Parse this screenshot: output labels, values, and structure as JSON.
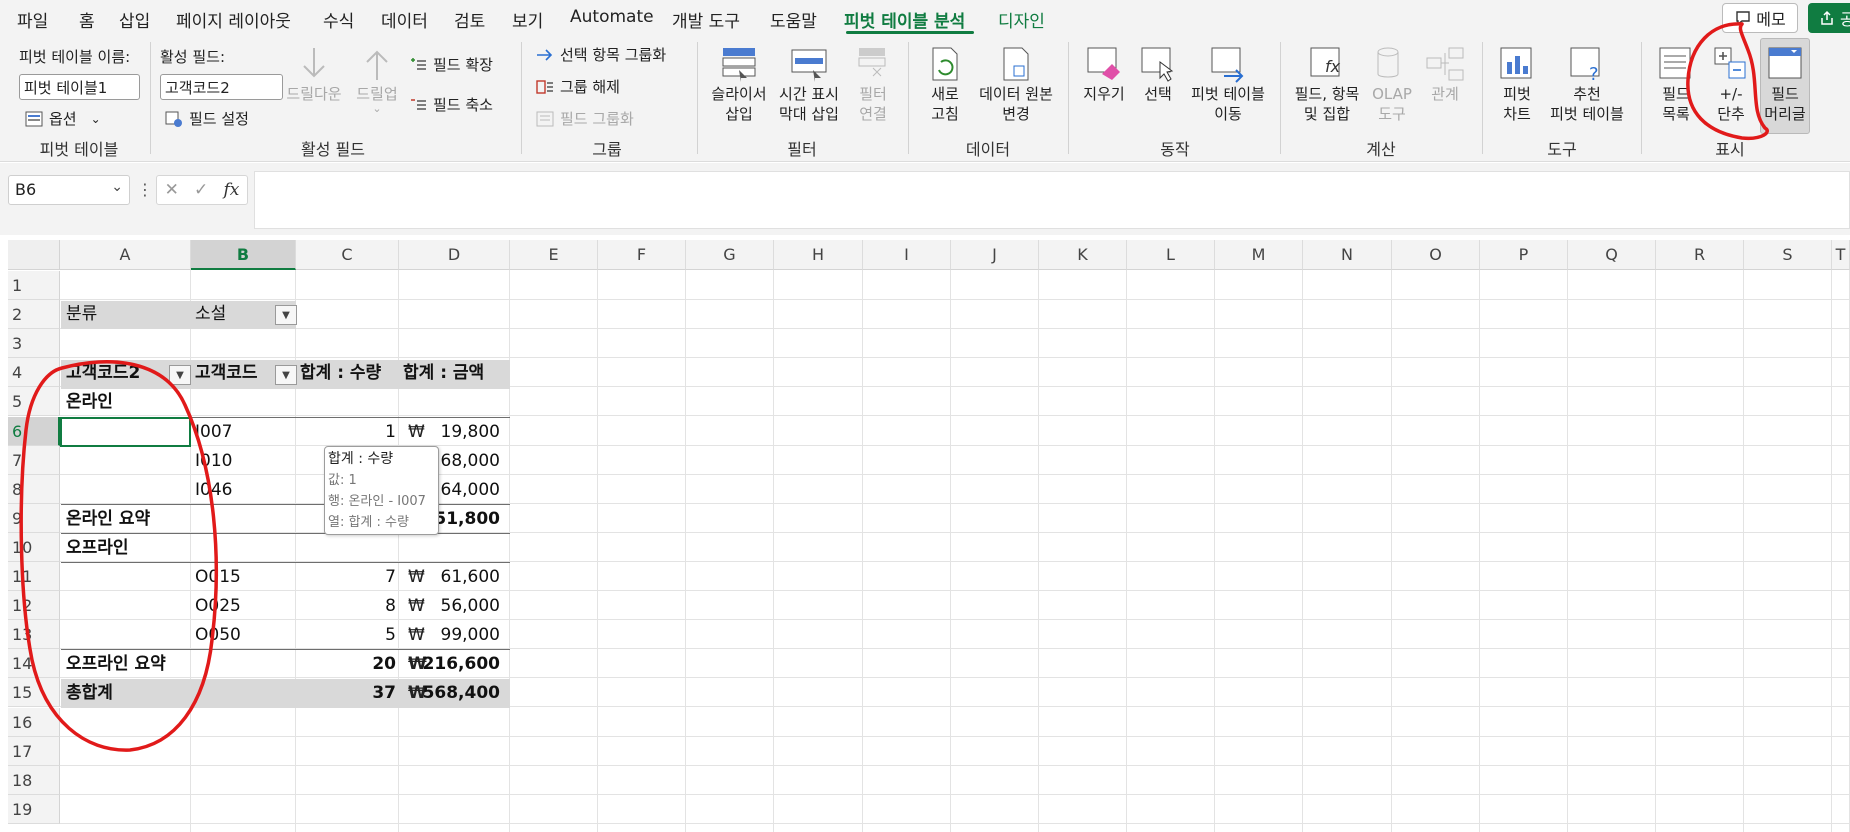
{
  "menu": {
    "tabs": [
      "파일",
      "홈",
      "삽입",
      "페이지 레이아웃",
      "수식",
      "데이터",
      "검토",
      "보기",
      "Automate",
      "개발 도구",
      "도움말",
      "피벗 테이블 분석",
      "디자인"
    ],
    "active_tab": "피벗 테이블 분석",
    "memo_label": "메모",
    "share_label": "공"
  },
  "ribbon": {
    "pivot_table": {
      "name_label": "피벗 테이블 이름:",
      "name_value": "피벗 테이블1",
      "options_label": "옵션",
      "group_label": "피벗 테이블"
    },
    "active_field": {
      "label": "활성 필드:",
      "value": "고객코드2",
      "settings_label": "필드 설정",
      "drill_down": "드릴다운",
      "drill_up": "드릴업",
      "expand": "필드 확장",
      "collapse": "필드 축소",
      "group_label": "활성 필드"
    },
    "group": {
      "group_selection": "선택 항목 그룹화",
      "ungroup": "그룹 해제",
      "group_field": "필드 그룹화",
      "group_label": "그룹"
    },
    "filter": {
      "slicer": [
        "슬라이서",
        "삽입"
      ],
      "timeline": [
        "시간 표시",
        "막대 삽입"
      ],
      "connections": [
        "필터",
        "연결"
      ],
      "group_label": "필터"
    },
    "data": {
      "refresh": [
        "새로",
        "고침"
      ],
      "change_source": [
        "데이터 원본",
        "변경"
      ],
      "group_label": "데이터"
    },
    "actions": {
      "clear": "지우기",
      "select": "선택",
      "move": [
        "피벗 테이블",
        "이동"
      ],
      "group_label": "동작"
    },
    "calculations": {
      "fields_items": [
        "필드, 항목",
        "및 집합"
      ],
      "olap": [
        "OLAP",
        "도구"
      ],
      "relationships": "관계",
      "group_label": "계산"
    },
    "tools": {
      "pivot_chart": [
        "피벗",
        "차트"
      ],
      "recommended": [
        "추천",
        "피벗 테이블"
      ],
      "group_label": "도구"
    },
    "show": {
      "field_list": [
        "필드",
        "목록"
      ],
      "buttons": [
        "+/-",
        "단추"
      ],
      "headers": [
        "필드",
        "머리글"
      ],
      "group_label": "표시"
    }
  },
  "formula_bar": {
    "name_box": "B6",
    "fx": "fx",
    "value": ""
  },
  "grid": {
    "columns": [
      "A",
      "B",
      "C",
      "D",
      "E",
      "F",
      "G",
      "H",
      "I",
      "J",
      "K",
      "L",
      "M",
      "N",
      "O",
      "P",
      "Q",
      "R",
      "S",
      "T"
    ],
    "rows": [
      "1",
      "2",
      "3",
      "4",
      "5",
      "6",
      "7",
      "8",
      "9",
      "10",
      "11",
      "12",
      "13",
      "14",
      "15",
      "16",
      "17",
      "18",
      "19"
    ],
    "selected_col": "B",
    "selected_row": "6"
  },
  "pivot": {
    "filter_label": "분류",
    "filter_value": "소설",
    "headers": [
      "고객코드2",
      "고객코드",
      "합계 : 수량",
      "합계 : 금액"
    ],
    "group1": {
      "name": "온라인",
      "rows": [
        {
          "code": "I007",
          "qty": "1",
          "amount": "19,800"
        },
        {
          "code": "I010",
          "qty": "",
          "amount": "68,000"
        },
        {
          "code": "I046",
          "qty": "",
          "amount": "264,000"
        }
      ],
      "subtotal_label": "온라인 요약",
      "subtotal_amount": "351,800"
    },
    "group2": {
      "name": "오프라인",
      "rows": [
        {
          "code": "O015",
          "qty": "7",
          "amount": "61,600"
        },
        {
          "code": "O025",
          "qty": "8",
          "amount": "56,000"
        },
        {
          "code": "O050",
          "qty": "5",
          "amount": "99,000"
        }
      ],
      "subtotal_label": "오프라인 요약",
      "subtotal_qty": "20",
      "subtotal_amount": "216,600"
    },
    "grand_total_label": "총합계",
    "grand_total_qty": "37",
    "grand_total_amount": "568,400",
    "currency": "₩"
  },
  "tooltip": {
    "lines": [
      "합계 : 수량",
      "값: 1",
      "행: 온라인 - I007",
      "열: 합계 : 수량"
    ]
  },
  "colors": {
    "accent": "#107c41",
    "annotation": "#e11a1a",
    "pivot_header_fill": "#d9d9d9"
  }
}
